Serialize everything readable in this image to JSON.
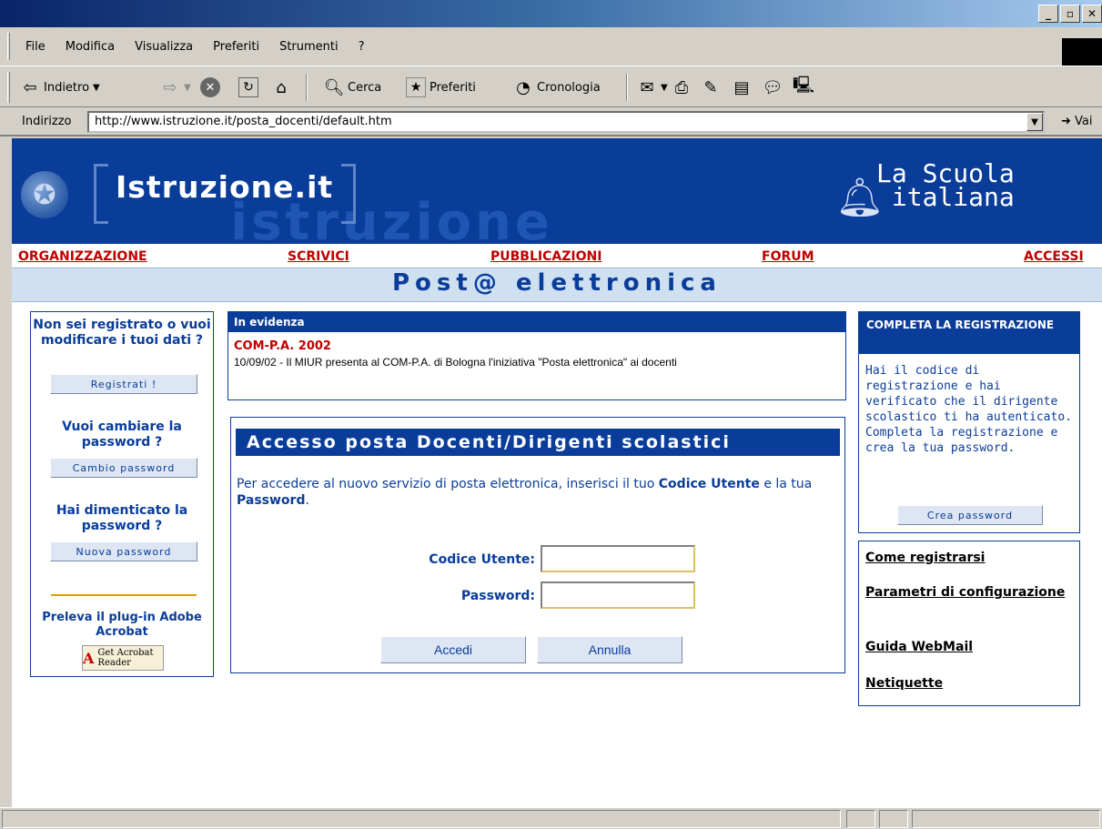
{
  "window": {
    "controls": [
      "_",
      "▫",
      "✕"
    ]
  },
  "menu": {
    "items": [
      "File",
      "Modifica",
      "Visualizza",
      "Preferiti",
      "Strumenti",
      "?"
    ]
  },
  "toolbar": {
    "back_label": "Indietro",
    "search_label": "Cerca",
    "favorites_label": "Preferiti",
    "history_label": "Cronologia"
  },
  "address": {
    "label": "Indirizzo",
    "url": "http://www.istruzione.it/posta_docenti/default.htm",
    "go_label": "Vai"
  },
  "banner": {
    "site_name": "Istruzione.it",
    "watermark": "istruzione",
    "scuola_line1": "La Scuola",
    "scuola_line2": "italiana"
  },
  "nav": {
    "items": [
      "ORGANIZZAZIONE",
      "SCRIVICI",
      "PUBBLICAZIONI",
      "FORUM",
      "ACCESSI"
    ]
  },
  "section_title": "Post@ elettronica",
  "left": {
    "q1": "Non sei registrato o vuoi modificare i tuoi dati ?",
    "btn_register": "Registrati !",
    "q2": "Vuoi cambiare la password ?",
    "btn_change": "Cambio password",
    "q3": "Hai dimenticato la password ?",
    "btn_new": "Nuova password",
    "acrobat_text": "Preleva il plug-in Adobe Acrobat",
    "acrobat_badge": "Get Acrobat Reader"
  },
  "evidence": {
    "header": "In evidenza",
    "headline": "COM-P.A. 2002",
    "body": "10/09/02 - Il MIUR presenta al COM-P.A. di Bologna l'iniziativa \"Posta elettronica\" ai docenti"
  },
  "login": {
    "title": "Accesso posta Docenti/Dirigenti scolastici",
    "intro_pre": "Per accedere al nuovo servizio di posta elettronica, inserisci il tuo ",
    "intro_code": "Codice Utente",
    "intro_mid": " e la tua ",
    "intro_pwd": "Password",
    "intro_end": ".",
    "user_label": "Codice Utente:",
    "user_value": "",
    "pwd_label": "Password:",
    "pwd_value": "",
    "btn_login": "Accedi",
    "btn_cancel": "Annulla"
  },
  "complete": {
    "header": "COMPLETA LA REGISTRAZIONE",
    "body": "Hai il codice di registrazione e hai verificato che il dirigente scolastico ti ha autenticato. Completa la registrazione e crea la tua password.",
    "btn": "Crea password"
  },
  "links": {
    "items": [
      "Come registrarsi",
      "Parametri di configurazione",
      "Guida WebMail",
      "Netiquette"
    ]
  }
}
